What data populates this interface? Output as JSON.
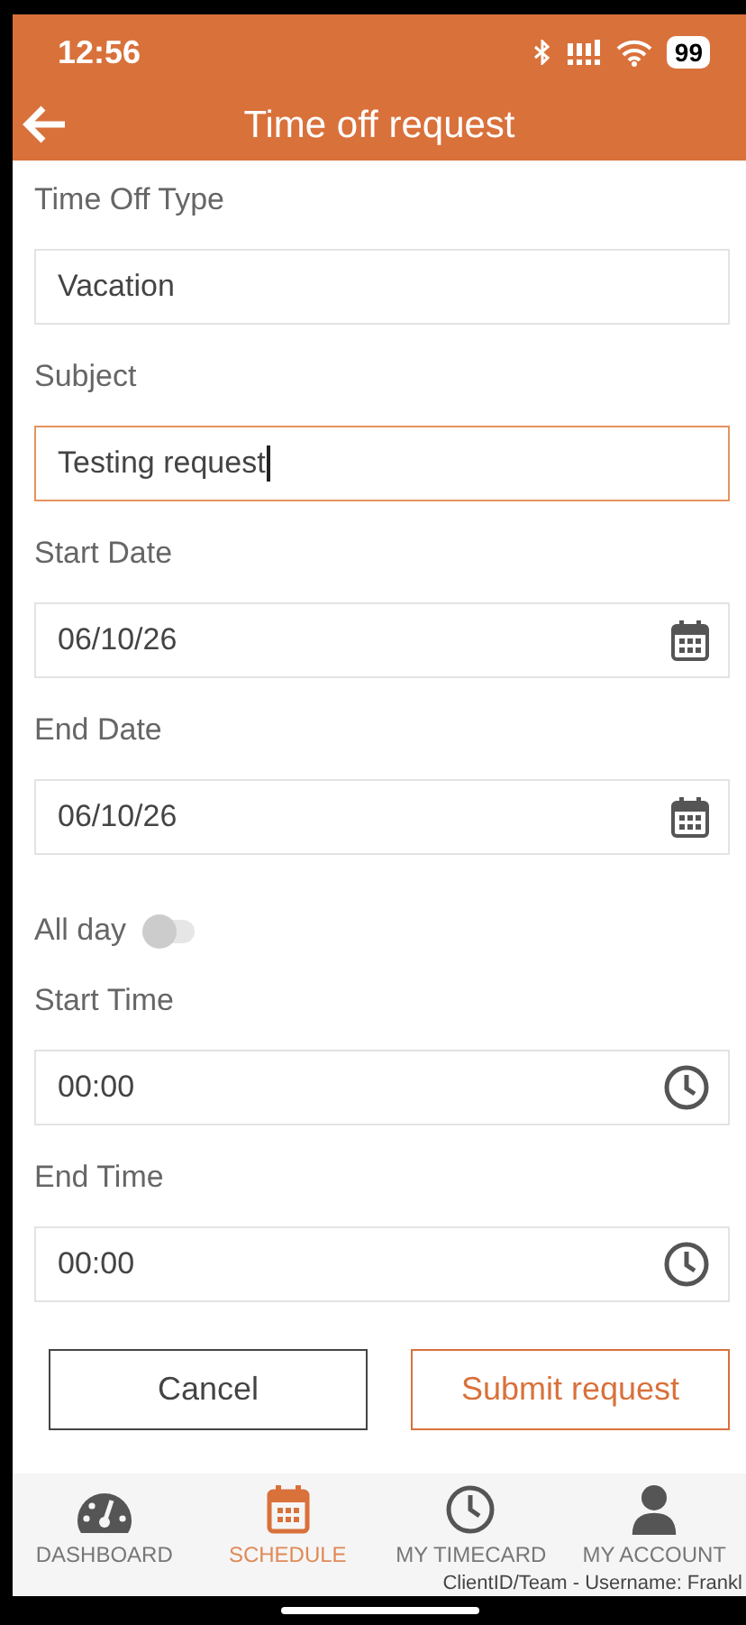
{
  "status_bar": {
    "time": "12:56",
    "battery": "99"
  },
  "header": {
    "title": "Time off request"
  },
  "fields": [
    {
      "kind": "text",
      "label": "Time Off Type",
      "value": "Vacation",
      "focused": false
    },
    {
      "kind": "text",
      "label": "Subject",
      "value": "Testing request",
      "focused": true
    },
    {
      "kind": "date",
      "label": "Start Date",
      "value": "06/10/26",
      "focused": false
    },
    {
      "kind": "date",
      "label": "End Date",
      "value": "06/10/26",
      "focused": false
    },
    {
      "kind": "toggle",
      "label": "All day",
      "on": false
    },
    {
      "kind": "time",
      "label": "Start Time",
      "value": "00:00",
      "focused": false
    },
    {
      "kind": "time",
      "label": "End Time",
      "value": "00:00",
      "focused": false
    }
  ],
  "buttons": [
    {
      "label": "Cancel",
      "kind": "secondary"
    },
    {
      "label": "Submit request",
      "kind": "primary"
    }
  ],
  "nav": [
    {
      "label": "DASHBOARD",
      "selected": false
    },
    {
      "label": "SCHEDULE",
      "selected": true
    },
    {
      "label": "MY TIMECARD",
      "selected": false
    },
    {
      "label": "MY ACCOUNT",
      "selected": false
    }
  ],
  "footer_overlay": "ClientID/Team - Username: Frankl"
}
